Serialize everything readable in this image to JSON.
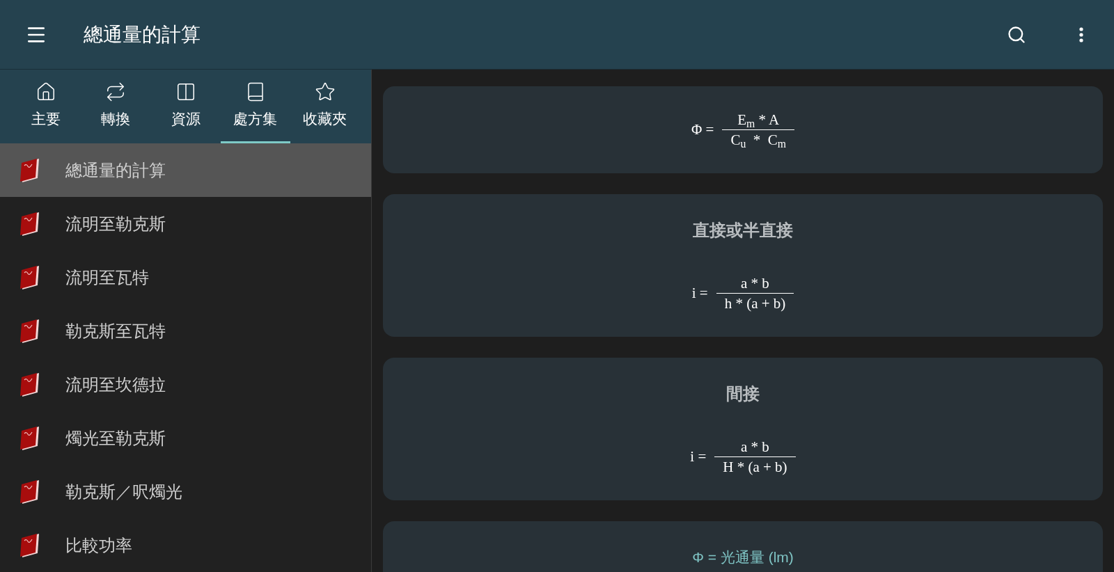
{
  "app_bar": {
    "title": "總通量的計算"
  },
  "tabs": [
    {
      "label": "主要",
      "selected": false
    },
    {
      "label": "轉換",
      "selected": false
    },
    {
      "label": "資源",
      "selected": false
    },
    {
      "label": "處方集",
      "selected": true
    },
    {
      "label": "收藏夾",
      "selected": false
    }
  ],
  "formulas": [
    {
      "label": "總通量的計算",
      "selected": true
    },
    {
      "label": "流明至勒克斯",
      "selected": false
    },
    {
      "label": "流明至瓦特",
      "selected": false
    },
    {
      "label": "勒克斯至瓦特",
      "selected": false
    },
    {
      "label": "流明至坎德拉",
      "selected": false
    },
    {
      "label": "燭光至勒克斯",
      "selected": false
    },
    {
      "label": "勒克斯／呎燭光",
      "selected": false
    },
    {
      "label": "比較功率",
      "selected": false
    }
  ],
  "cards": [
    {
      "kind": "equation",
      "lhs": "Φ =",
      "numerator": "E$_{m}$ * A",
      "denominator": "C$_{u}$  *  C$_{m}$"
    },
    {
      "kind": "equation",
      "heading": "直接或半直接",
      "lhs": "i =",
      "numerator": "a * b",
      "denominator": "h * (a + b)"
    },
    {
      "kind": "equation",
      "heading": "間接",
      "lhs": "i =",
      "numerator": "a * b",
      "denominator": "H * (a + b)"
    },
    {
      "kind": "legend",
      "lines": [
        "Φ = 光通量 (lm)"
      ]
    }
  ]
}
